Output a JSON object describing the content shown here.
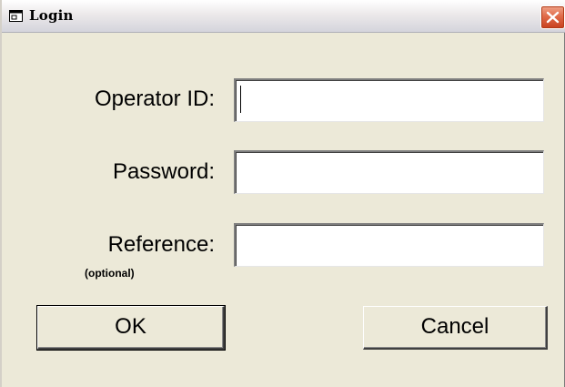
{
  "window": {
    "title": "Login",
    "close_label": "Close"
  },
  "form": {
    "operator_id": {
      "label": "Operator ID:",
      "value": "",
      "placeholder": ""
    },
    "password": {
      "label": "Password:",
      "value": "",
      "placeholder": ""
    },
    "reference": {
      "label": "Reference:",
      "sub_label": "(optional)",
      "value": "",
      "placeholder": ""
    }
  },
  "buttons": {
    "ok_label": "OK",
    "cancel_label": "Cancel"
  },
  "icons": {
    "title_icon": "window-app-icon",
    "close_icon": "close-icon"
  },
  "colors": {
    "dialog_bg": "#ece9d8",
    "close_button": "#e06a48"
  }
}
